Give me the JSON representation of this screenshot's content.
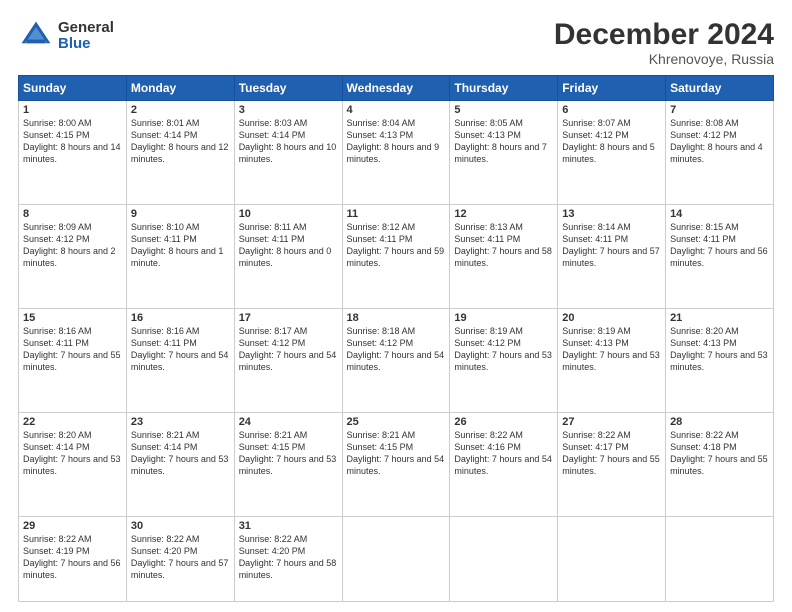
{
  "logo": {
    "general": "General",
    "blue": "Blue"
  },
  "header": {
    "month": "December 2024",
    "location": "Khrenovoye, Russia"
  },
  "days_of_week": [
    "Sunday",
    "Monday",
    "Tuesday",
    "Wednesday",
    "Thursday",
    "Friday",
    "Saturday"
  ],
  "weeks": [
    [
      {
        "day": "1",
        "sunrise": "8:00 AM",
        "sunset": "4:15 PM",
        "daylight": "8 hours and 14 minutes."
      },
      {
        "day": "2",
        "sunrise": "8:01 AM",
        "sunset": "4:14 PM",
        "daylight": "8 hours and 12 minutes."
      },
      {
        "day": "3",
        "sunrise": "8:03 AM",
        "sunset": "4:14 PM",
        "daylight": "8 hours and 10 minutes."
      },
      {
        "day": "4",
        "sunrise": "8:04 AM",
        "sunset": "4:13 PM",
        "daylight": "8 hours and 9 minutes."
      },
      {
        "day": "5",
        "sunrise": "8:05 AM",
        "sunset": "4:13 PM",
        "daylight": "8 hours and 7 minutes."
      },
      {
        "day": "6",
        "sunrise": "8:07 AM",
        "sunset": "4:12 PM",
        "daylight": "8 hours and 5 minutes."
      },
      {
        "day": "7",
        "sunrise": "8:08 AM",
        "sunset": "4:12 PM",
        "daylight": "8 hours and 4 minutes."
      }
    ],
    [
      {
        "day": "8",
        "sunrise": "8:09 AM",
        "sunset": "4:12 PM",
        "daylight": "8 hours and 2 minutes."
      },
      {
        "day": "9",
        "sunrise": "8:10 AM",
        "sunset": "4:11 PM",
        "daylight": "8 hours and 1 minute."
      },
      {
        "day": "10",
        "sunrise": "8:11 AM",
        "sunset": "4:11 PM",
        "daylight": "8 hours and 0 minutes."
      },
      {
        "day": "11",
        "sunrise": "8:12 AM",
        "sunset": "4:11 PM",
        "daylight": "7 hours and 59 minutes."
      },
      {
        "day": "12",
        "sunrise": "8:13 AM",
        "sunset": "4:11 PM",
        "daylight": "7 hours and 58 minutes."
      },
      {
        "day": "13",
        "sunrise": "8:14 AM",
        "sunset": "4:11 PM",
        "daylight": "7 hours and 57 minutes."
      },
      {
        "day": "14",
        "sunrise": "8:15 AM",
        "sunset": "4:11 PM",
        "daylight": "7 hours and 56 minutes."
      }
    ],
    [
      {
        "day": "15",
        "sunrise": "8:16 AM",
        "sunset": "4:11 PM",
        "daylight": "7 hours and 55 minutes."
      },
      {
        "day": "16",
        "sunrise": "8:16 AM",
        "sunset": "4:11 PM",
        "daylight": "7 hours and 54 minutes."
      },
      {
        "day": "17",
        "sunrise": "8:17 AM",
        "sunset": "4:12 PM",
        "daylight": "7 hours and 54 minutes."
      },
      {
        "day": "18",
        "sunrise": "8:18 AM",
        "sunset": "4:12 PM",
        "daylight": "7 hours and 54 minutes."
      },
      {
        "day": "19",
        "sunrise": "8:19 AM",
        "sunset": "4:12 PM",
        "daylight": "7 hours and 53 minutes."
      },
      {
        "day": "20",
        "sunrise": "8:19 AM",
        "sunset": "4:13 PM",
        "daylight": "7 hours and 53 minutes."
      },
      {
        "day": "21",
        "sunrise": "8:20 AM",
        "sunset": "4:13 PM",
        "daylight": "7 hours and 53 minutes."
      }
    ],
    [
      {
        "day": "22",
        "sunrise": "8:20 AM",
        "sunset": "4:14 PM",
        "daylight": "7 hours and 53 minutes."
      },
      {
        "day": "23",
        "sunrise": "8:21 AM",
        "sunset": "4:14 PM",
        "daylight": "7 hours and 53 minutes."
      },
      {
        "day": "24",
        "sunrise": "8:21 AM",
        "sunset": "4:15 PM",
        "daylight": "7 hours and 53 minutes."
      },
      {
        "day": "25",
        "sunrise": "8:21 AM",
        "sunset": "4:15 PM",
        "daylight": "7 hours and 54 minutes."
      },
      {
        "day": "26",
        "sunrise": "8:22 AM",
        "sunset": "4:16 PM",
        "daylight": "7 hours and 54 minutes."
      },
      {
        "day": "27",
        "sunrise": "8:22 AM",
        "sunset": "4:17 PM",
        "daylight": "7 hours and 55 minutes."
      },
      {
        "day": "28",
        "sunrise": "8:22 AM",
        "sunset": "4:18 PM",
        "daylight": "7 hours and 55 minutes."
      }
    ],
    [
      {
        "day": "29",
        "sunrise": "8:22 AM",
        "sunset": "4:19 PM",
        "daylight": "7 hours and 56 minutes."
      },
      {
        "day": "30",
        "sunrise": "8:22 AM",
        "sunset": "4:20 PM",
        "daylight": "7 hours and 57 minutes."
      },
      {
        "day": "31",
        "sunrise": "8:22 AM",
        "sunset": "4:20 PM",
        "daylight": "7 hours and 58 minutes."
      },
      null,
      null,
      null,
      null
    ]
  ],
  "labels": {
    "sunrise": "Sunrise:",
    "sunset": "Sunset:",
    "daylight": "Daylight:"
  }
}
